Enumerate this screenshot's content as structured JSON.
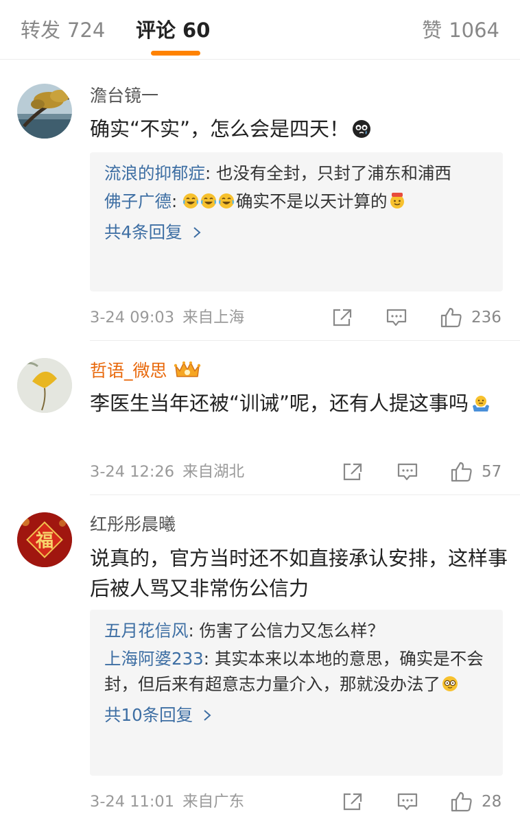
{
  "tabs": {
    "repost": {
      "label": "转发",
      "count": "724"
    },
    "comments": {
      "label": "评论",
      "count": "60"
    },
    "likes": {
      "label": "赞",
      "count": "1064"
    }
  },
  "colors": {
    "accent": "#ff8200",
    "link": "#3d6ea3",
    "vip_name": "#e8680b"
  },
  "comments": [
    {
      "user": "澹台镜一",
      "text": "确实“不实”，怎么会是四天！",
      "text_emoji": "crying-face-emoji",
      "replies": [
        {
          "user": "流浪的抑郁症",
          "sep": ": ",
          "text": "也没有全封，只封了浦东和浦西"
        },
        {
          "user": "佛子广德",
          "sep": ": ",
          "text": "确实不是以天计算的",
          "emoji": "laugh-cry-emoji x3, 666-emoji"
        }
      ],
      "more": "共4条回复",
      "date": "3-24 09:03",
      "source": "来自上海",
      "like_count": "236"
    },
    {
      "user": "哲语_微思",
      "badge": "vip-crown-icon",
      "text": "李医生当年还被“训诫”呢，还有人提这事吗",
      "text_emoji": "shrug-emoji",
      "date": "3-24 12:26",
      "source": "来自湖北",
      "like_count": "57"
    },
    {
      "user": "红彤彤晨曦",
      "text": "说真的，官方当时还不如直接承认安排，这样事后被人骂又非常伤公信力",
      "replies": [
        {
          "user": "五月花信风",
          "sep": ": ",
          "text": "伤害了公信力又怎么样？"
        },
        {
          "user": "上海阿婆233",
          "sep": ": ",
          "text": "其实本来以本地的意思，确实是不会封，但后来有超意志力量介入，那就没办法了",
          "emoji": "glasses-face-emoji"
        }
      ],
      "more": "共10条回复",
      "date": "3-24 11:01",
      "source": "来自广东",
      "like_count": "28"
    }
  ]
}
